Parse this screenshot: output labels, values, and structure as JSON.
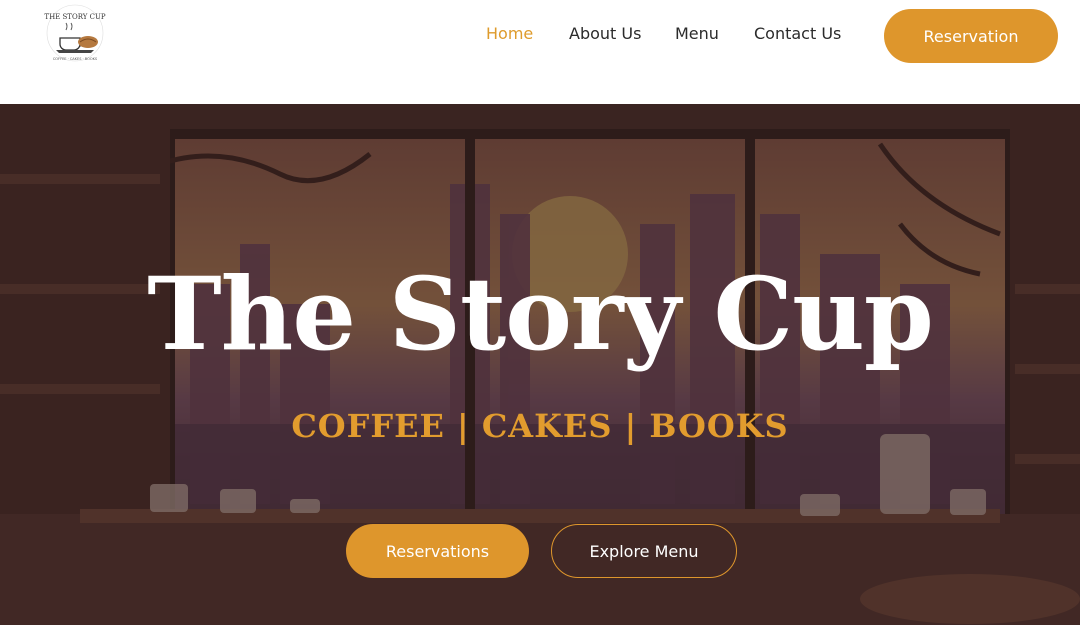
{
  "brand": {
    "logo_icon": "coffee-cup-with-book-icon",
    "logo_top": "THE STORY CUP",
    "logo_bottom": "COFFEE · CAKES · BOOKS"
  },
  "nav": {
    "items": [
      {
        "label": "Home",
        "active": true
      },
      {
        "label": "About Us",
        "active": false
      },
      {
        "label": "Menu",
        "active": false
      },
      {
        "label": "Contact Us",
        "active": false
      }
    ],
    "reservation_label": "Reservation"
  },
  "hero": {
    "title": "The Story Cup",
    "subtitle": "COFFEE | CAKES | BOOKS",
    "primary_button": "Reservations",
    "secondary_button": "Explore Menu"
  },
  "colors": {
    "accent": "#de962c",
    "nav_text": "#2b2b2b",
    "hero_overlay": "#3a2320"
  }
}
